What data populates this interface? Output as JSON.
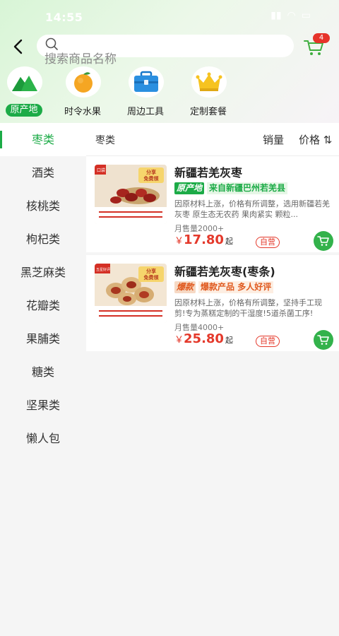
{
  "status_bar": {
    "time": "14:55"
  },
  "search": {
    "placeholder": "搜索商品名称"
  },
  "cart": {
    "count": "4"
  },
  "categories": [
    {
      "label": "原产地",
      "icon": "mountain-icon"
    },
    {
      "label": "时令水果",
      "icon": "orange-fruit-icon"
    },
    {
      "label": "周边工具",
      "icon": "toolbox-icon"
    },
    {
      "label": "定制套餐",
      "icon": "crown-icon"
    }
  ],
  "sidebar": {
    "items": [
      {
        "label": "枣类"
      },
      {
        "label": "酒类"
      },
      {
        "label": "核桃类"
      },
      {
        "label": "枸杞类"
      },
      {
        "label": "黑芝麻类"
      },
      {
        "label": "花瓣类"
      },
      {
        "label": "果脯类"
      },
      {
        "label": "糖类"
      },
      {
        "label": "坚果类"
      },
      {
        "label": "懒人包"
      }
    ]
  },
  "sort_bar": {
    "title": "枣类",
    "sales": "销量",
    "price": "价格 ⇅"
  },
  "products": [
    {
      "title": "新疆若羌灰枣",
      "tag": "原产地",
      "tag_text": "来自新疆巴州若羌县",
      "desc": "因原材料上涨，价格有所调整，选用新疆若羌灰枣 原生态无农药 果肉紧实 颗粒...",
      "sales": "月售量2000+",
      "price_symbol": "￥",
      "price": "17.80",
      "price_suffix": "起",
      "badge": "自营",
      "img_label_share": "分享",
      "img_label_free": "免费领",
      "img_corner": "口袋"
    },
    {
      "title": "新疆若羌灰枣(枣条)",
      "tag": "爆款",
      "tag_text": "爆款产品 多人好评",
      "desc": "因原材料上涨，价格有所调整，坚持手工现剪!专为蒸糕定制的干湿度!5道杀菌工序!",
      "sales": "月售量4000+",
      "price_symbol": "￥",
      "price": "25.80",
      "price_suffix": "起",
      "badge": "自营",
      "img_label_share": "分享",
      "img_label_free": "免费领",
      "img_corner": "五星好评"
    }
  ],
  "colors": {
    "accent": "#1cab47",
    "price": "#e4392b",
    "cart": "#33b24b"
  }
}
